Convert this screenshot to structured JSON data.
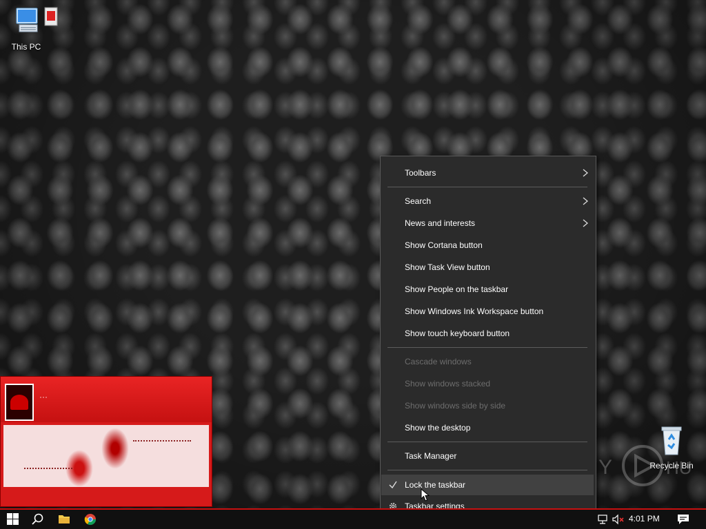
{
  "desktop": {
    "icons": [
      {
        "label": "This PC",
        "icon": "computer-icon"
      },
      {
        "label": "Recycle Bin",
        "icon": "recycle-bin-icon"
      }
    ]
  },
  "context_menu": {
    "toolbars": "Toolbars",
    "search": "Search",
    "news": "News and interests",
    "cortana": "Show Cortana button",
    "taskview": "Show Task View button",
    "people": "Show People on the taskbar",
    "ink": "Show Windows Ink Workspace button",
    "keyboard": "Show touch keyboard button",
    "cascade": "Cascade windows",
    "stacked": "Show windows stacked",
    "side_by_side": "Show windows side by side",
    "show_desktop": "Show the desktop",
    "task_manager": "Task Manager",
    "lock_taskbar": "Lock the taskbar",
    "lock_checked": true,
    "settings": "Taskbar settings"
  },
  "taskbar": {
    "time": "4:01 PM",
    "pinned": [
      "start-icon",
      "search-icon",
      "file-explorer-icon",
      "chrome-icon"
    ],
    "tray": [
      "network-icon",
      "volume-muted-icon",
      "notification-icon"
    ]
  },
  "colors": {
    "menu_bg": "#2b2b2b",
    "menu_hover": "#414141",
    "disabled_text": "#6d6d6d",
    "taskbar_accent": "#c81010"
  }
}
